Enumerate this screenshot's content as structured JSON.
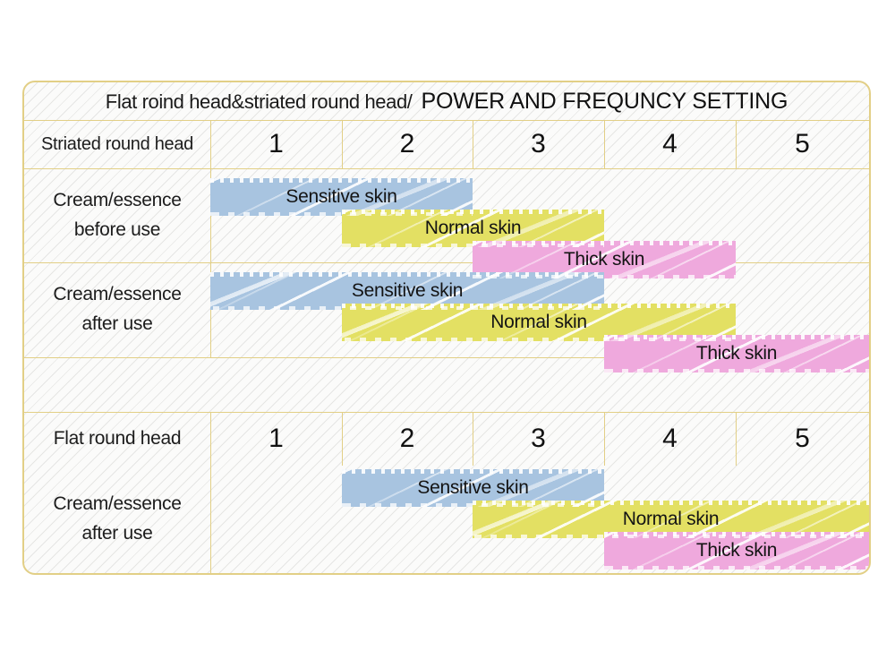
{
  "table": {
    "title_part1": "Flat roind head&striated round head/",
    "title_part2": "POWER AND FREQUNCY SETTING",
    "colors": {
      "border": "#e2cf86",
      "sensitive": "#a8c4e0",
      "normal": "#e3e063",
      "thick": "#efa9dd",
      "background": "#fbfbfa",
      "text": "#1a1a1a"
    },
    "power_levels": [
      "1",
      "2",
      "3",
      "4",
      "5"
    ],
    "head_rows": [
      {
        "label": "Striated round head",
        "levels": [
          "1",
          "2",
          "3",
          "4",
          "5"
        ]
      },
      {
        "label": "Flat round head",
        "levels": [
          "1",
          "2",
          "3",
          "4",
          "5"
        ]
      }
    ],
    "usage_rows": [
      {
        "label_line1": "Cream/essence",
        "label_line2": "before use",
        "bars": [
          {
            "name": "Sensitive skin",
            "from": 1,
            "to": 2,
            "color": "sensitive"
          },
          {
            "name": "Normal skin",
            "from": 2,
            "to": 3,
            "color": "normal"
          },
          {
            "name": "Thick skin",
            "from": 3,
            "to": 4,
            "color": "thick"
          }
        ]
      },
      {
        "label_line1": "Cream/essence",
        "label_line2": "after use",
        "bars": [
          {
            "name": "Sensitive skin",
            "from": 1,
            "to": 3,
            "color": "sensitive"
          },
          {
            "name": "Normal skin",
            "from": 2,
            "to": 4,
            "color": "normal"
          },
          {
            "name": "Thick skin",
            "from": 4,
            "to": 5,
            "color": "thick"
          }
        ]
      },
      {
        "label_line1": "Cream/essence",
        "label_line2": "after use",
        "bars": [
          {
            "name": "Sensitive skin",
            "from": 2,
            "to": 3,
            "color": "sensitive"
          },
          {
            "name": "Normal skin",
            "from": 3,
            "to": 5,
            "color": "normal"
          },
          {
            "name": "Thick skin",
            "from": 4,
            "to": 5,
            "color": "thick"
          }
        ]
      }
    ]
  },
  "cells": {
    "r1c1": "1",
    "r1c2": "2",
    "r1c3": "3",
    "r1c4": "4",
    "r1c5": "5",
    "r2c1": "1",
    "r2c2": "2",
    "r2c3": "3",
    "r2c4": "4",
    "r2c5": "5"
  },
  "labels": {
    "striated_round_head": "Striated round head",
    "flat_round_head": "Flat round head",
    "cream_before_1": "Cream/essence",
    "cream_before_2": "before use",
    "cream_after_a_1": "Cream/essence",
    "cream_after_a_2": "after use",
    "cream_after_b_1": "Cream/essence",
    "cream_after_b_2": "after use"
  },
  "bars": {
    "row1": {
      "sensitive": "Sensitive skin",
      "normal": "Normal skin",
      "thick": "Thick skin"
    },
    "row2": {
      "sensitive": "Sensitive skin",
      "normal": "Normal skin",
      "thick": "Thick skin"
    },
    "row3": {
      "sensitive": "Sensitive skin",
      "normal": "Normal skin",
      "thick": "Thick skin"
    }
  }
}
